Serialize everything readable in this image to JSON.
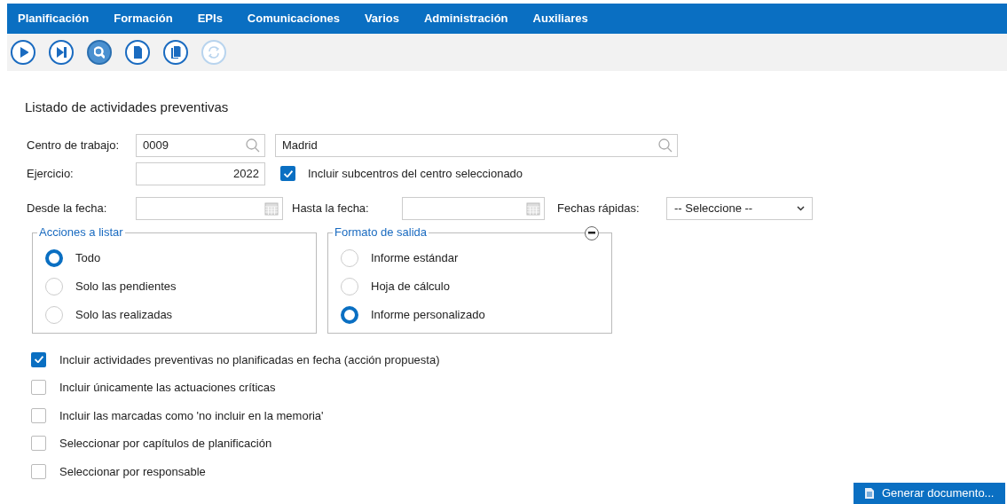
{
  "menu": [
    {
      "label": "Planificación"
    },
    {
      "label": "Formación"
    },
    {
      "label": "EPIs"
    },
    {
      "label": "Comunicaciones"
    },
    {
      "label": "Varios"
    },
    {
      "label": "Administración"
    },
    {
      "label": "Auxiliares"
    }
  ],
  "toolbar": [
    {
      "kind": "play",
      "active": false,
      "disabled": false
    },
    {
      "kind": "next",
      "active": false,
      "disabled": false
    },
    {
      "kind": "search",
      "active": true,
      "disabled": false
    },
    {
      "kind": "document",
      "active": false,
      "disabled": false
    },
    {
      "kind": "documents",
      "active": false,
      "disabled": false
    },
    {
      "kind": "refresh",
      "active": false,
      "disabled": true
    }
  ],
  "title": "Listado de actividades preventivas",
  "centro": {
    "label": "Centro de trabajo:",
    "code": "0009",
    "name": "Madrid"
  },
  "ejercicio": {
    "label": "Ejercicio:",
    "value": "2022"
  },
  "subcentros": {
    "label": "Incluir subcentros del centro seleccionado",
    "checked": true
  },
  "desde": {
    "label": "Desde la fecha:"
  },
  "hasta": {
    "label": "Hasta la fecha:"
  },
  "fechas_rapidas": {
    "label": "Fechas rápidas:",
    "value": "-- Seleccione --"
  },
  "groups": [
    {
      "legend": "Acciones a listar",
      "collapse_button": false,
      "options": [
        {
          "label": "Todo",
          "selected": true
        },
        {
          "label": "Solo las pendientes",
          "selected": false
        },
        {
          "label": "Solo las realizadas",
          "selected": false
        }
      ]
    },
    {
      "legend": "Formato de salida",
      "collapse_button": true,
      "options": [
        {
          "label": "Informe estándar",
          "selected": false
        },
        {
          "label": "Hoja de cálculo",
          "selected": false
        },
        {
          "label": "Informe personalizado",
          "selected": true
        }
      ]
    }
  ],
  "checks": [
    {
      "label": "Incluir actividades preventivas no planificadas en fecha (acción propuesta)",
      "checked": true
    },
    {
      "label": "Incluir únicamente las actuaciones críticas",
      "checked": false
    },
    {
      "label": "Incluir las marcadas como 'no incluir en la memoria'",
      "checked": false
    },
    {
      "label": "Seleccionar por capítulos de planificación",
      "checked": false
    },
    {
      "label": "Seleccionar por responsable",
      "checked": false
    }
  ],
  "generate_button": "Generar documento..."
}
